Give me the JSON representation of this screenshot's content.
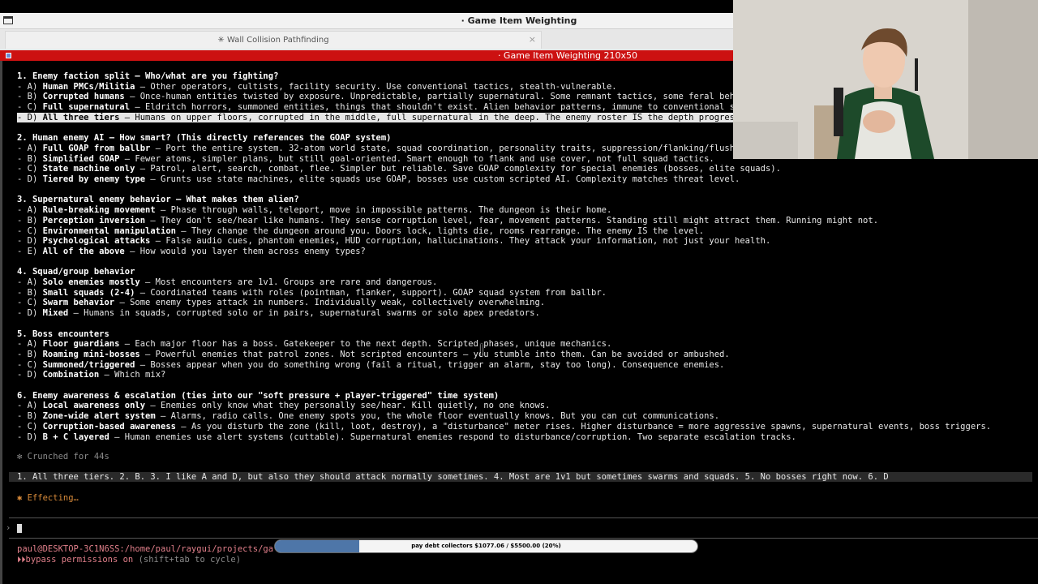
{
  "window": {
    "title": "· Game Item Weighting"
  },
  "tab": {
    "label": "✳ Wall Collision Pathfinding",
    "close": "×"
  },
  "pane": {
    "title": "· Game Item Weighting 210x50"
  },
  "terminal": {
    "lines": [
      {
        "t": "heading",
        "text": "1. Enemy faction split — Who/what are you fighting?"
      },
      {
        "b": "Human PMCs/Militia",
        "pre": "- A) ",
        "rest": " — Other operators, cultists, facility security. Use conventional tactics, stealth-vulnerable."
      },
      {
        "b": "Corrupted humans",
        "pre": "- B) ",
        "rest": " — Once-human entities twisted by exposure. Unpredictable, partially supernatural. Some remnant tactics, some feral beh"
      },
      {
        "b": "Full supernatural",
        "pre": "- C) ",
        "rest": " — Eldritch horrors, summoned entities, things that shouldn't exist. Alien behavior patterns, immune to conventional s"
      },
      {
        "b": "All three tiers",
        "pre": "- D) ",
        "rest": " — Humans on upper floors, corrupted in the middle, full supernatural in the deep. The enemy roster IS the depth progres",
        "hl": true
      },
      {
        "t": "heading",
        "text": "2. Human enemy AI — How smart? (This directly references the GOAP system)"
      },
      {
        "b": "Full GOAP from ballbr",
        "pre": "- A) ",
        "rest": " — Port the entire system. 32-atom world state, squad coordination, personality traits, suppression/flanking/flush"
      },
      {
        "b": "Simplified GOAP",
        "pre": "- B) ",
        "rest": " — Fewer atoms, simpler plans, but still goal-oriented. Smart enough to flank and use cover, not full squad tactics."
      },
      {
        "b": "State machine only",
        "pre": "- C) ",
        "rest": " — Patrol, alert, search, combat, flee. Simpler but reliable. Save GOAP complexity for special enemies (bosses, elite squads)."
      },
      {
        "b": "Tiered by enemy type",
        "pre": "- D) ",
        "rest": " — Grunts use state machines, elite squads use GOAP, bosses use custom scripted AI. Complexity matches threat level."
      },
      {
        "t": "heading",
        "text": "3. Supernatural enemy behavior — What makes them alien?"
      },
      {
        "b": "Rule-breaking movement",
        "pre": "- A) ",
        "rest": " — Phase through walls, teleport, move in impossible patterns. The dungeon is their home."
      },
      {
        "b": "Perception inversion",
        "pre": "- B) ",
        "rest": " — They don't see/hear like humans. They sense corruption level, fear, movement patterns. Standing still might attract them. Running might not."
      },
      {
        "b": "Environmental manipulation",
        "pre": "- C) ",
        "rest": " — They change the dungeon around you. Doors lock, lights die, rooms rearrange. The enemy IS the level."
      },
      {
        "b": "Psychological attacks",
        "pre": "- D) ",
        "rest": " — False audio cues, phantom enemies, HUD corruption, hallucinations. They attack your information, not just your health."
      },
      {
        "b": "All of the above",
        "pre": "- E) ",
        "rest": " — How would you layer them across enemy types?"
      },
      {
        "t": "heading",
        "text": "4. Squad/group behavior"
      },
      {
        "b": "Solo enemies mostly",
        "pre": "- A) ",
        "rest": " — Most encounters are 1v1. Groups are rare and dangerous."
      },
      {
        "b": "Small squads (2-4)",
        "pre": "- B) ",
        "rest": " — Coordinated teams with roles (pointman, flanker, support). GOAP squad system from ballbr."
      },
      {
        "b": "Swarm behavior",
        "pre": "- C) ",
        "rest": " — Some enemy types attack in numbers. Individually weak, collectively overwhelming."
      },
      {
        "b": "Mixed",
        "pre": "- D) ",
        "rest": " — Humans in squads, corrupted solo or in pairs, supernatural swarms or solo apex predators."
      },
      {
        "t": "heading",
        "text": "5. Boss encounters"
      },
      {
        "b": "Floor guardians",
        "pre": "- A) ",
        "rest": " — Each major floor has a boss. Gatekeeper to the next depth. Scripted phases, unique mechanics."
      },
      {
        "b": "Roaming mini-bosses",
        "pre": "- B) ",
        "rest": " — Powerful enemies that patrol zones. Not scripted encounters — you stumble into them. Can be avoided or ambushed."
      },
      {
        "b": "Summoned/triggered",
        "pre": "- C) ",
        "rest": " — Bosses appear when you do something wrong (fail a ritual, trigger an alarm, stay too long). Consequence enemies."
      },
      {
        "b": "Combination",
        "pre": "- D) ",
        "rest": " — Which mix?"
      },
      {
        "t": "heading",
        "text": "6. Enemy awareness & escalation (ties into our \"soft pressure + player-triggered\" time system)"
      },
      {
        "b": "Local awareness only",
        "pre": "- A) ",
        "rest": " — Enemies only know what they personally see/hear. Kill quietly, no one knows."
      },
      {
        "b": "Zone-wide alert system",
        "pre": "- B) ",
        "rest": " — Alarms, radio calls. One enemy spots you, the whole floor eventually knows. But you can cut communications."
      },
      {
        "b": "Corruption-based awareness",
        "pre": "- C) ",
        "rest": " — As you disturb the zone (kill, loot, destroy), a \"disturbance\" meter rises. Higher disturbance = more aggressive spawns, supernatural events, boss triggers."
      },
      {
        "b": "B + C layered",
        "pre": "- D) ",
        "rest": " — Human enemies use alert systems (cuttable). Supernatural enemies respond to disturbance/corruption. Two separate escalation tracks."
      }
    ],
    "crunched": "✻ Crunched for 44s",
    "user_reply": "1. All three tiers. 2. B. 3. I like A and D, but also they should attack normally sometimes. 4. Most are 1v1 but sometimes swarms and squads. 5. No bosses right now. 6. D",
    "effecting": "✱ Effecting…",
    "prompt_symbol": "›",
    "status_path": "paul@DESKTOP-3C1N6SS:/home/paul/raygui/projects/ga",
    "bypass_icon": "⏵⏵",
    "bypass_text": "bypass permissions on",
    "bypass_hint": " (shift+tab to cycle)"
  },
  "progress": {
    "label": "pay debt collectors $1077.06 / $5500.00 (20%)",
    "fraction": 0.2
  },
  "webcam": {
    "desc_name": "webcam-overlay"
  },
  "colors": {
    "accent_red": "#cc1111",
    "progress_fill": "#4e76a8",
    "orange": "#d98b3a"
  }
}
